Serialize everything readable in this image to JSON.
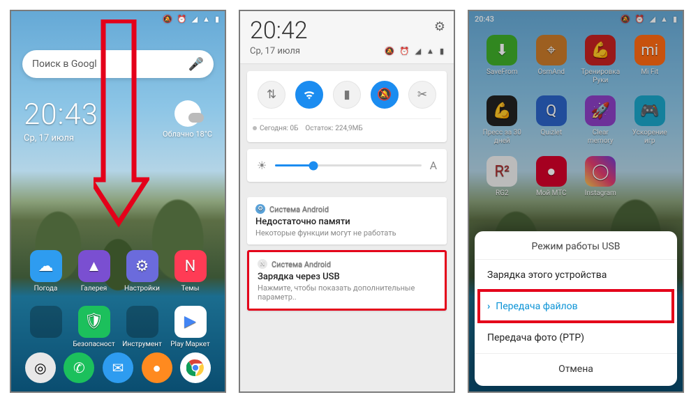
{
  "status": {
    "time1": "20:43",
    "time3": "20:43",
    "date": "Ср, 17 июля",
    "time2": "20:42",
    "date2": "Ср, 17 июля"
  },
  "search": {
    "placeholder": "Поиск в Googl"
  },
  "weather": {
    "cond": "Облачно",
    "temp": "18°C"
  },
  "home_apps": [
    {
      "label": "Погода",
      "color": "#2e9cf0",
      "glyph": "☁"
    },
    {
      "label": "Галерея",
      "color": "#7a4fd1",
      "glyph": "▲"
    },
    {
      "label": "Настройки",
      "color": "#6b6bdc",
      "glyph": "⚙"
    },
    {
      "label": "Темы",
      "color": "#ff3b55",
      "glyph": "N"
    },
    {
      "label": "",
      "folder": true
    },
    {
      "label": "Безопасност",
      "color": "#1cc05c",
      "glyph": "🛡"
    },
    {
      "label": "Инструмент",
      "folder": true
    },
    {
      "label": "Play Маркет",
      "color": "#ffffff",
      "glyph": "▶"
    }
  ],
  "dock": [
    {
      "name": "phone",
      "color": "#1cc05c",
      "glyph": "📞"
    },
    {
      "name": "sms",
      "color": "#2e9cf0",
      "glyph": "✉"
    },
    {
      "name": "browser",
      "color": "#ff8a1f",
      "glyph": "●"
    },
    {
      "name": "chrome",
      "color": "#ffffff",
      "glyph": "◐"
    }
  ],
  "qs": {
    "tiles": [
      {
        "name": "mobile-data",
        "glyph": "⇅",
        "on": false
      },
      {
        "name": "wifi",
        "glyph": "✔",
        "on": true,
        "shape": "wifi"
      },
      {
        "name": "flashlight",
        "glyph": "▮",
        "on": false
      },
      {
        "name": "dnd",
        "glyph": "🔕",
        "on": true
      },
      {
        "name": "screenshot",
        "glyph": "✂",
        "on": false
      }
    ],
    "usage_today_label": "Сегодня: 0Б",
    "usage_remain_label": "Остаток: 224,9МБ"
  },
  "notifications": [
    {
      "app": "Система Android",
      "title": "Недостаточно памяти",
      "body": "Некоторые функции могут не работать",
      "icon_bg": "#5aa2d8",
      "icon": "⚙"
    },
    {
      "app": "Система Android",
      "title": "Зарядка через USB",
      "body": "Нажмите, чтобы показать дополнительные параметр..",
      "icon_bg": "#e8e8e8",
      "icon": "N",
      "highlighted": true
    }
  ],
  "phone3_apps": [
    {
      "label": "SaveFrom",
      "color": "#3fae2a",
      "glyph": "⬇"
    },
    {
      "label": "OsmAnd",
      "color": "#c97a2a",
      "glyph": "⌖"
    },
    {
      "label": "Тренировка\nРуки",
      "color": "#c52020",
      "glyph": "💪"
    },
    {
      "label": "Mi Fit",
      "color": "#ff6a13",
      "glyph": "mi"
    },
    {
      "label": "Пресс за 30\nдней",
      "color": "#222",
      "glyph": "💪"
    },
    {
      "label": "Quizlet",
      "color": "#2b63c7",
      "glyph": "Q"
    },
    {
      "label": "Clear\nmemory",
      "color": "#8c3fc4",
      "glyph": "🚀"
    },
    {
      "label": "Ускорение\nигр",
      "color": "#1aa4c8",
      "glyph": "🎮"
    },
    {
      "label": "RG2",
      "color": "#f0f0f0",
      "glyph": "R²"
    },
    {
      "label": "Мой МТС",
      "color": "#d4002a",
      "glyph": "●"
    },
    {
      "label": "Instagram",
      "color": "linear-gradient(45deg,#f5c850,#e23b6e,#6d3bd1)",
      "glyph": "◯"
    }
  ],
  "usb_dialog": {
    "title": "Режим работы USB",
    "options": [
      {
        "label": "Зарядка этого устройства",
        "selected": false
      },
      {
        "label": "Передача файлов",
        "selected": true,
        "highlighted": true
      },
      {
        "label": "Передача фото (PTP)",
        "selected": false
      }
    ],
    "cancel": "Отмена"
  }
}
